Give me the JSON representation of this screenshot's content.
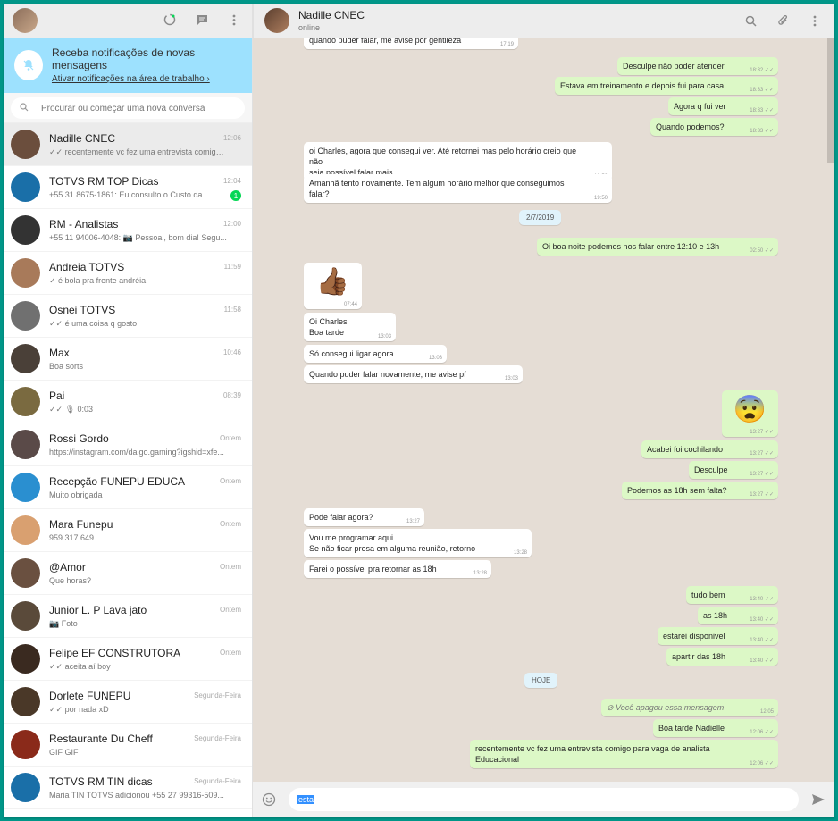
{
  "sidebar": {
    "notification": {
      "title": "Receba notificações de novas mensagens",
      "link": "Ativar notificações na área de trabalho ›"
    },
    "search_placeholder": "Procurar ou começar uma nova conversa",
    "chats": [
      {
        "name": "Nadille CNEC",
        "last": "✓✓ recentemente vc fez uma entrevista comigo p...",
        "time": "12:06",
        "meta": "",
        "color": "#6b4e3d"
      },
      {
        "name": "TOTVS RM TOP Dicas",
        "last": "+55 31 8675-1861: Eu consulto o Custo da...",
        "time": "12:04",
        "meta": "1",
        "color": "#1a6fa8"
      },
      {
        "name": "RM - Analistas",
        "last": "+55 11 94006-4048: 📷 Pessoal, bom dia! Segu...",
        "time": "12:00",
        "meta": "",
        "color": "#333333"
      },
      {
        "name": "Andreia TOTVS",
        "last": "✓ é bola pra frente andréia",
        "time": "11:59",
        "meta": "",
        "color": "#a87a5a"
      },
      {
        "name": "Osnei TOTVS",
        "last": "✓✓ é uma coisa q gosto",
        "time": "11:58",
        "meta": "",
        "color": "#707070"
      },
      {
        "name": "Max",
        "last": "Boa sorts",
        "time": "10:46",
        "meta": "",
        "color": "#4a4038"
      },
      {
        "name": "Pai",
        "last": "✓✓ 🎙 0:03",
        "time": "08:39",
        "meta": "",
        "color": "#7a6a40"
      },
      {
        "name": "Rossi Gordo",
        "last": "https://instagram.com/daigo.gaming?igshid=xfe...",
        "time": "Ontem",
        "meta": "",
        "color": "#5a4a48"
      },
      {
        "name": "Recepção FUNEPU EDUCA",
        "last": "Muito obrigada",
        "time": "Ontem",
        "meta": "",
        "color": "#2a8fd0"
      },
      {
        "name": "Mara Funepu",
        "last": "959 317 649",
        "time": "Ontem",
        "meta": "",
        "color": "#d9a070"
      },
      {
        "name": "@Amor",
        "last": "Que horas?",
        "time": "Ontem",
        "meta": "",
        "color": "#6a5040"
      },
      {
        "name": "Junior L. P Lava jato",
        "last": "📷 Foto",
        "time": "Ontem",
        "meta": "",
        "color": "#5a4a3a"
      },
      {
        "name": "Felipe EF CONSTRUTORA",
        "last": "✓✓ aceita aí boy",
        "time": "Ontem",
        "meta": "",
        "color": "#3a2a20"
      },
      {
        "name": "Dorlete FUNEPU",
        "last": "✓✓ por nada xD",
        "time": "Segunda-Feira",
        "meta": "",
        "color": "#4a3828"
      },
      {
        "name": "Restaurante Du Cheff",
        "last": "GIF GIF",
        "time": "Segunda-Feira",
        "meta": "",
        "color": "#8a2a1a"
      },
      {
        "name": "TOTVS RM TIN dicas",
        "last": "Maria TIN TOTVS adicionou +55 27 99316-509...",
        "time": "Segunda-Feira",
        "meta": "",
        "color": "#1a6fa8"
      }
    ]
  },
  "header": {
    "name": "Nadille CNEC",
    "status": "online"
  },
  "conversation": {
    "messages": [
      {
        "dir": "in",
        "text": "quando puder falar, me avise por gentileza",
        "time": "17:19"
      },
      {
        "dir": "out",
        "text": "Desculpe não poder atender",
        "time": "18:32 ✓✓"
      },
      {
        "dir": "out",
        "text": "Estava em treinamento e depois fui para casa",
        "time": "18:33 ✓✓"
      },
      {
        "dir": "out",
        "text": "Agora q fui ver",
        "time": "18:33 ✓✓"
      },
      {
        "dir": "out",
        "text": "Quando podemos?",
        "time": "18:33 ✓✓"
      },
      {
        "dir": "in",
        "text": "oi Charles, agora que consegui ver. Até retornei mas pelo horário creio que não\nseja possível falar mais.",
        "time": "19:50"
      },
      {
        "dir": "in",
        "text": "Amanhã tento novamente. Tem algum horário melhor que conseguimos falar?",
        "time": "19:50"
      },
      {
        "dir": "out",
        "text": "Oi boa noite podemos nos falar entre 12:10 e 13h",
        "time": "02:50 ✓✓"
      },
      {
        "dir": "in",
        "text": "👍🏾",
        "time": "07:44"
      },
      {
        "dir": "in",
        "text": "Oi Charles\nBoa tarde",
        "time": "13:03"
      },
      {
        "dir": "in",
        "text": "Só consegui ligar agora",
        "time": "13:03"
      },
      {
        "dir": "in",
        "text": "Quando puder falar novamente, me avise pf",
        "time": "13:03"
      },
      {
        "dir": "out",
        "text": "😨",
        "time": "13:27 ✓✓"
      },
      {
        "dir": "out",
        "text": "Acabei foi cochilando",
        "time": "13:27 ✓✓"
      },
      {
        "dir": "out",
        "text": "Desculpe",
        "time": "13:27 ✓✓"
      },
      {
        "dir": "out",
        "text": "Podemos as 18h sem falta?",
        "time": "13:27 ✓✓"
      },
      {
        "dir": "in",
        "text": "Pode falar agora?",
        "time": "13:27"
      },
      {
        "dir": "in",
        "text": "Vou me programar aqui\nSe não ficar presa em alguma reunião, retorno",
        "time": "13:28"
      },
      {
        "dir": "in",
        "text": "Farei o possível pra retornar as 18h",
        "time": "13:28"
      },
      {
        "dir": "out",
        "text": "tudo bem",
        "time": "13:40 ✓✓"
      },
      {
        "dir": "out",
        "text": "as 18h",
        "time": "13:40 ✓✓"
      },
      {
        "dir": "out",
        "text": "estarei disponivel",
        "time": "13:40 ✓✓"
      },
      {
        "dir": "out",
        "text": "apartir das 18h",
        "time": "13:40 ✓✓"
      },
      {
        "dir": "out",
        "text": "⊘ Você apagou essa mensagem",
        "time": "12:05"
      },
      {
        "dir": "out",
        "text": "Boa tarde Nadielle",
        "time": "12:06 ✓✓"
      },
      {
        "dir": "out",
        "text": "recentemente vc fez uma entrevista comigo para vaga de analista Educacional",
        "time": "12:06 ✓✓"
      }
    ],
    "date_pills": [
      "2/7/2019",
      "HOJE"
    ]
  },
  "composer": {
    "value": "esta"
  },
  "colors": {
    "accent": "#009688",
    "outgoing": "#dcf8c6",
    "incoming": "#ffffff",
    "background": "#e5ddd5",
    "notification": "#9de1fe",
    "unread": "#06d755"
  },
  "icons": [
    "status-icon",
    "new-chat-icon",
    "menu-icon",
    "search-icon",
    "attach-icon",
    "emoji-icon",
    "send-icon"
  ]
}
